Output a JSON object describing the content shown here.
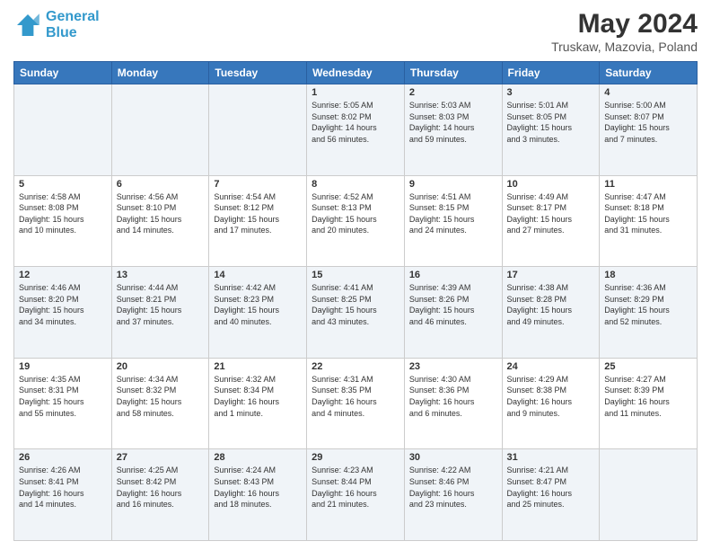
{
  "header": {
    "logo_line1": "General",
    "logo_line2": "Blue",
    "title": "May 2024",
    "subtitle": "Truskaw, Mazovia, Poland"
  },
  "weekdays": [
    "Sunday",
    "Monday",
    "Tuesday",
    "Wednesday",
    "Thursday",
    "Friday",
    "Saturday"
  ],
  "weeks": [
    [
      {
        "day": "",
        "info": ""
      },
      {
        "day": "",
        "info": ""
      },
      {
        "day": "",
        "info": ""
      },
      {
        "day": "1",
        "info": "Sunrise: 5:05 AM\nSunset: 8:02 PM\nDaylight: 14 hours\nand 56 minutes."
      },
      {
        "day": "2",
        "info": "Sunrise: 5:03 AM\nSunset: 8:03 PM\nDaylight: 14 hours\nand 59 minutes."
      },
      {
        "day": "3",
        "info": "Sunrise: 5:01 AM\nSunset: 8:05 PM\nDaylight: 15 hours\nand 3 minutes."
      },
      {
        "day": "4",
        "info": "Sunrise: 5:00 AM\nSunset: 8:07 PM\nDaylight: 15 hours\nand 7 minutes."
      }
    ],
    [
      {
        "day": "5",
        "info": "Sunrise: 4:58 AM\nSunset: 8:08 PM\nDaylight: 15 hours\nand 10 minutes."
      },
      {
        "day": "6",
        "info": "Sunrise: 4:56 AM\nSunset: 8:10 PM\nDaylight: 15 hours\nand 14 minutes."
      },
      {
        "day": "7",
        "info": "Sunrise: 4:54 AM\nSunset: 8:12 PM\nDaylight: 15 hours\nand 17 minutes."
      },
      {
        "day": "8",
        "info": "Sunrise: 4:52 AM\nSunset: 8:13 PM\nDaylight: 15 hours\nand 20 minutes."
      },
      {
        "day": "9",
        "info": "Sunrise: 4:51 AM\nSunset: 8:15 PM\nDaylight: 15 hours\nand 24 minutes."
      },
      {
        "day": "10",
        "info": "Sunrise: 4:49 AM\nSunset: 8:17 PM\nDaylight: 15 hours\nand 27 minutes."
      },
      {
        "day": "11",
        "info": "Sunrise: 4:47 AM\nSunset: 8:18 PM\nDaylight: 15 hours\nand 31 minutes."
      }
    ],
    [
      {
        "day": "12",
        "info": "Sunrise: 4:46 AM\nSunset: 8:20 PM\nDaylight: 15 hours\nand 34 minutes."
      },
      {
        "day": "13",
        "info": "Sunrise: 4:44 AM\nSunset: 8:21 PM\nDaylight: 15 hours\nand 37 minutes."
      },
      {
        "day": "14",
        "info": "Sunrise: 4:42 AM\nSunset: 8:23 PM\nDaylight: 15 hours\nand 40 minutes."
      },
      {
        "day": "15",
        "info": "Sunrise: 4:41 AM\nSunset: 8:25 PM\nDaylight: 15 hours\nand 43 minutes."
      },
      {
        "day": "16",
        "info": "Sunrise: 4:39 AM\nSunset: 8:26 PM\nDaylight: 15 hours\nand 46 minutes."
      },
      {
        "day": "17",
        "info": "Sunrise: 4:38 AM\nSunset: 8:28 PM\nDaylight: 15 hours\nand 49 minutes."
      },
      {
        "day": "18",
        "info": "Sunrise: 4:36 AM\nSunset: 8:29 PM\nDaylight: 15 hours\nand 52 minutes."
      }
    ],
    [
      {
        "day": "19",
        "info": "Sunrise: 4:35 AM\nSunset: 8:31 PM\nDaylight: 15 hours\nand 55 minutes."
      },
      {
        "day": "20",
        "info": "Sunrise: 4:34 AM\nSunset: 8:32 PM\nDaylight: 15 hours\nand 58 minutes."
      },
      {
        "day": "21",
        "info": "Sunrise: 4:32 AM\nSunset: 8:34 PM\nDaylight: 16 hours\nand 1 minute."
      },
      {
        "day": "22",
        "info": "Sunrise: 4:31 AM\nSunset: 8:35 PM\nDaylight: 16 hours\nand 4 minutes."
      },
      {
        "day": "23",
        "info": "Sunrise: 4:30 AM\nSunset: 8:36 PM\nDaylight: 16 hours\nand 6 minutes."
      },
      {
        "day": "24",
        "info": "Sunrise: 4:29 AM\nSunset: 8:38 PM\nDaylight: 16 hours\nand 9 minutes."
      },
      {
        "day": "25",
        "info": "Sunrise: 4:27 AM\nSunset: 8:39 PM\nDaylight: 16 hours\nand 11 minutes."
      }
    ],
    [
      {
        "day": "26",
        "info": "Sunrise: 4:26 AM\nSunset: 8:41 PM\nDaylight: 16 hours\nand 14 minutes."
      },
      {
        "day": "27",
        "info": "Sunrise: 4:25 AM\nSunset: 8:42 PM\nDaylight: 16 hours\nand 16 minutes."
      },
      {
        "day": "28",
        "info": "Sunrise: 4:24 AM\nSunset: 8:43 PM\nDaylight: 16 hours\nand 18 minutes."
      },
      {
        "day": "29",
        "info": "Sunrise: 4:23 AM\nSunset: 8:44 PM\nDaylight: 16 hours\nand 21 minutes."
      },
      {
        "day": "30",
        "info": "Sunrise: 4:22 AM\nSunset: 8:46 PM\nDaylight: 16 hours\nand 23 minutes."
      },
      {
        "day": "31",
        "info": "Sunrise: 4:21 AM\nSunset: 8:47 PM\nDaylight: 16 hours\nand 25 minutes."
      },
      {
        "day": "",
        "info": ""
      }
    ]
  ]
}
